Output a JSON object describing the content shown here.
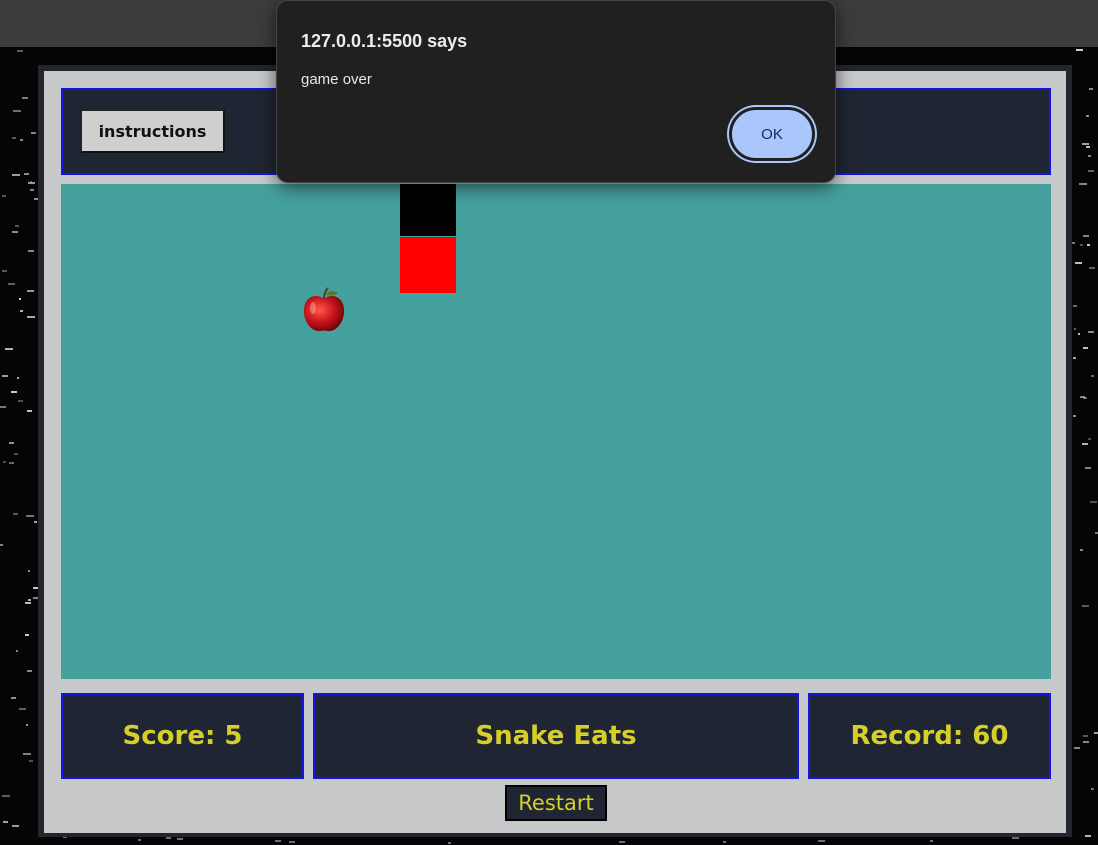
{
  "browser_dialog": {
    "origin_text": "127.0.0.1:5500 says",
    "message": "game over",
    "ok_label": "OK"
  },
  "header": {
    "instructions_label": "instructions"
  },
  "game": {
    "snake_colors": {
      "head": "#000000",
      "body": "#ff0000"
    },
    "board_color": "#45a19e",
    "food_icon": "apple-icon"
  },
  "footer": {
    "score_text": "Score: 5",
    "title_text": "Snake Eats",
    "record_text": "Record: 60",
    "restart_label": "Restart"
  },
  "colors": {
    "panel_bg": "#1f2532",
    "panel_border": "#1414e6",
    "accent_text": "#d6cf2a",
    "ok_button": "#a9c7fa"
  }
}
